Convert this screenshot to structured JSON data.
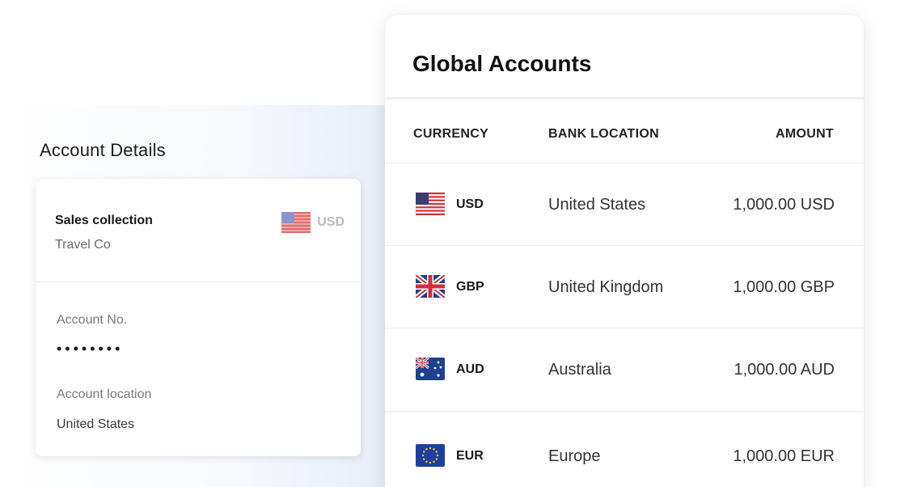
{
  "account_details": {
    "title": "Account Details",
    "collection_name": "Sales collection",
    "collection_sub": "Travel Co",
    "collection_currency": "USD",
    "collection_flag_icon": "us-flag-icon",
    "account_no_label": "Account No.",
    "account_no_value": "••••••••",
    "account_location_label": "Account location",
    "account_location_value": "United States"
  },
  "global_accounts": {
    "title": "Global Accounts",
    "columns": {
      "currency": "CURRENCY",
      "bank_location": "BANK LOCATION",
      "amount": "AMOUNT"
    },
    "rows": [
      {
        "currency": "USD",
        "location": "United States",
        "amount": "1,000.00 USD",
        "flag_icon": "us-flag-icon"
      },
      {
        "currency": "GBP",
        "location": "United Kingdom",
        "amount": "1,000.00 GBP",
        "flag_icon": "uk-flag-icon"
      },
      {
        "currency": "AUD",
        "location": "Australia",
        "amount": "1,000.00 AUD",
        "flag_icon": "au-flag-icon"
      },
      {
        "currency": "EUR",
        "location": "Europe",
        "amount": "1,000.00 EUR",
        "flag_icon": "eu-flag-icon"
      }
    ]
  },
  "colors": {
    "background": "#ffffff",
    "card": "#ffffff",
    "muted_text": "#7a7a7a",
    "divider": "#ececec"
  }
}
